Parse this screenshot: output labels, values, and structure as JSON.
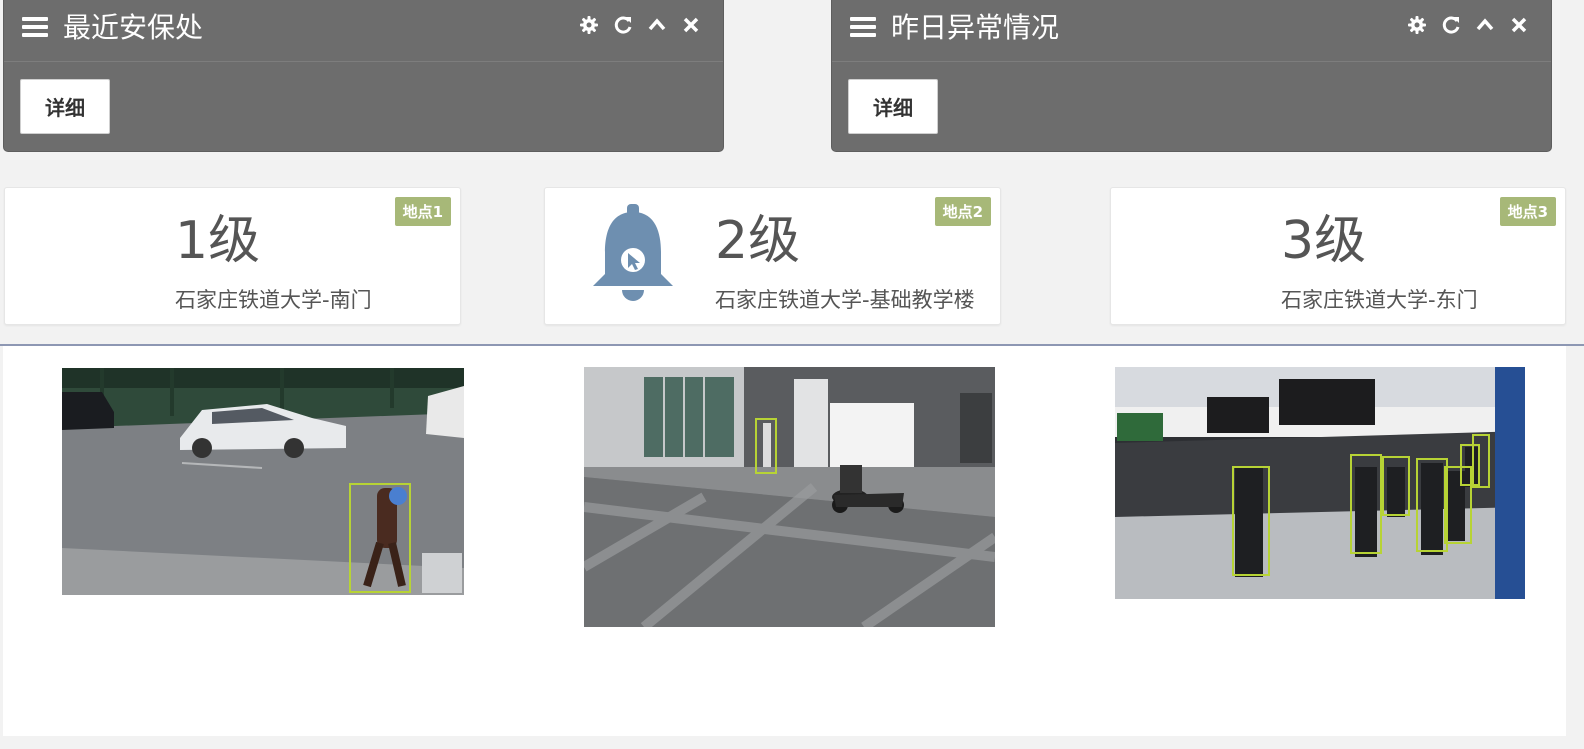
{
  "panels": [
    {
      "title": "最近安保处",
      "detail_label": "详细"
    },
    {
      "title": "昨日异常情况",
      "detail_label": "详细"
    }
  ],
  "icons": {
    "menu": "hamburger-menu-icon",
    "tools": [
      "gear-icon",
      "refresh-icon",
      "chevron-up-icon",
      "close-icon"
    ],
    "alert": "bell-icon"
  },
  "cards": [
    {
      "badge": "地点1",
      "level": "1级",
      "place": "石家庄铁道大学-南门"
    },
    {
      "badge": "地点2",
      "level": "2级",
      "place": "石家庄铁道大学-基础教学楼"
    },
    {
      "badge": "地点3",
      "level": "3级",
      "place": "石家庄铁道大学-东门"
    }
  ],
  "colors": {
    "panel_bg": "#6d6d6d",
    "badge_bg": "#a7b878",
    "bell": "#6e8fb0",
    "detection_box": "#b7d335",
    "divider": "#8d97b3"
  }
}
